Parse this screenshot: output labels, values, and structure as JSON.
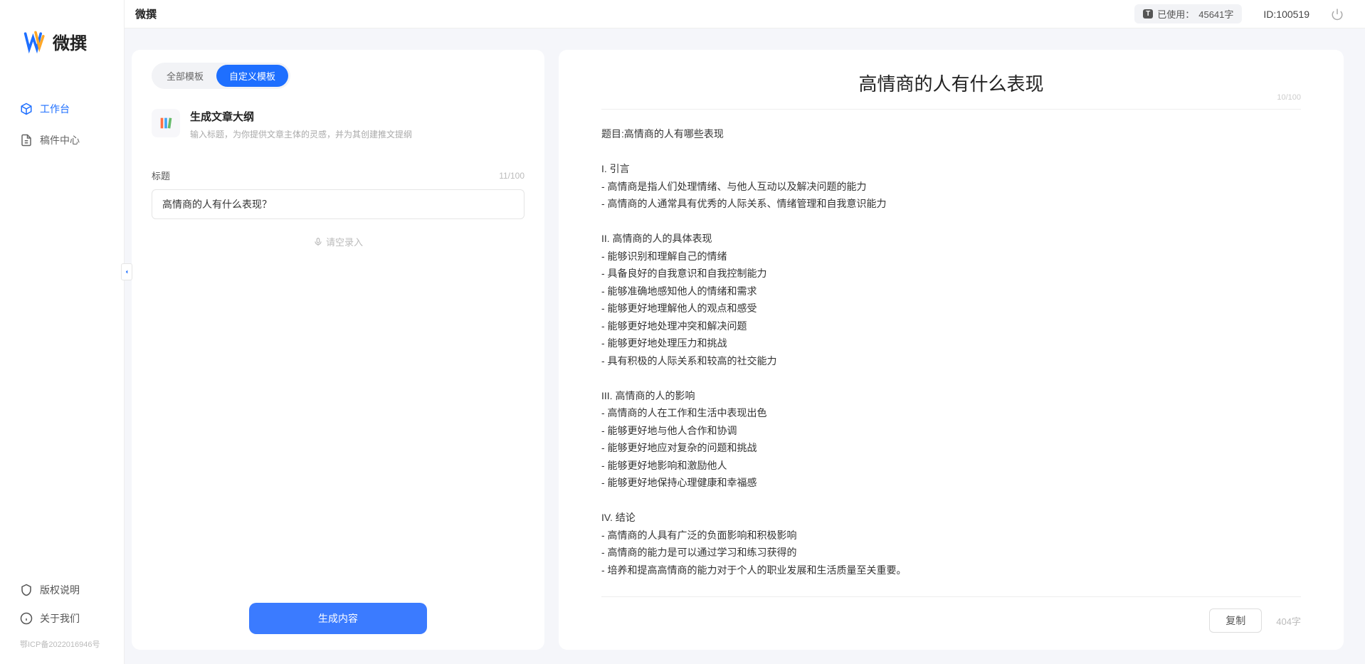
{
  "brand": {
    "name": "微撰"
  },
  "sidebar": {
    "items": [
      {
        "label": "工作台",
        "active": true
      },
      {
        "label": "稿件中心",
        "active": false
      }
    ],
    "footer": [
      {
        "label": "版权说明"
      },
      {
        "label": "关于我们"
      }
    ],
    "icp": "鄂ICP备2022016946号"
  },
  "topbar": {
    "title": "微撰",
    "usage_prefix": "已使用：",
    "usage_value": "45641字",
    "user_id": "ID:100519"
  },
  "template": {
    "tabs": [
      {
        "label": "全部模板",
        "active": false
      },
      {
        "label": "自定义模板",
        "active": true
      }
    ],
    "card": {
      "title": "生成文章大纲",
      "desc": "输入标题，为你提供文章主体的灵感，并为其创建推文提纲"
    },
    "form": {
      "label": "标题",
      "char_count": "11/100",
      "value": "高情商的人有什么表现？",
      "voice_hint": "请空录入"
    },
    "generate_label": "生成内容"
  },
  "output": {
    "title": "高情商的人有什么表现",
    "title_count": "10/100",
    "body": "题目:高情商的人有哪些表现\n\nI. 引言\n- 高情商是指人们处理情绪、与他人互动以及解决问题的能力\n- 高情商的人通常具有优秀的人际关系、情绪管理和自我意识能力\n\nII. 高情商的人的具体表现\n- 能够识别和理解自己的情绪\n- 具备良好的自我意识和自我控制能力\n- 能够准确地感知他人的情绪和需求\n- 能够更好地理解他人的观点和感受\n- 能够更好地处理冲突和解决问题\n- 能够更好地处理压力和挑战\n- 具有积极的人际关系和较高的社交能力\n\nIII. 高情商的人的影响\n- 高情商的人在工作和生活中表现出色\n- 能够更好地与他人合作和协调\n- 能够更好地应对复杂的问题和挑战\n- 能够更好地影响和激励他人\n- 能够更好地保持心理健康和幸福感\n\nIV. 结论\n- 高情商的人具有广泛的负面影响和积极影响\n- 高情商的能力是可以通过学习和练习获得的\n- 培养和提高高情商的能力对于个人的职业发展和生活质量至关重要。",
    "copy_label": "复制",
    "word_count": "404字"
  }
}
